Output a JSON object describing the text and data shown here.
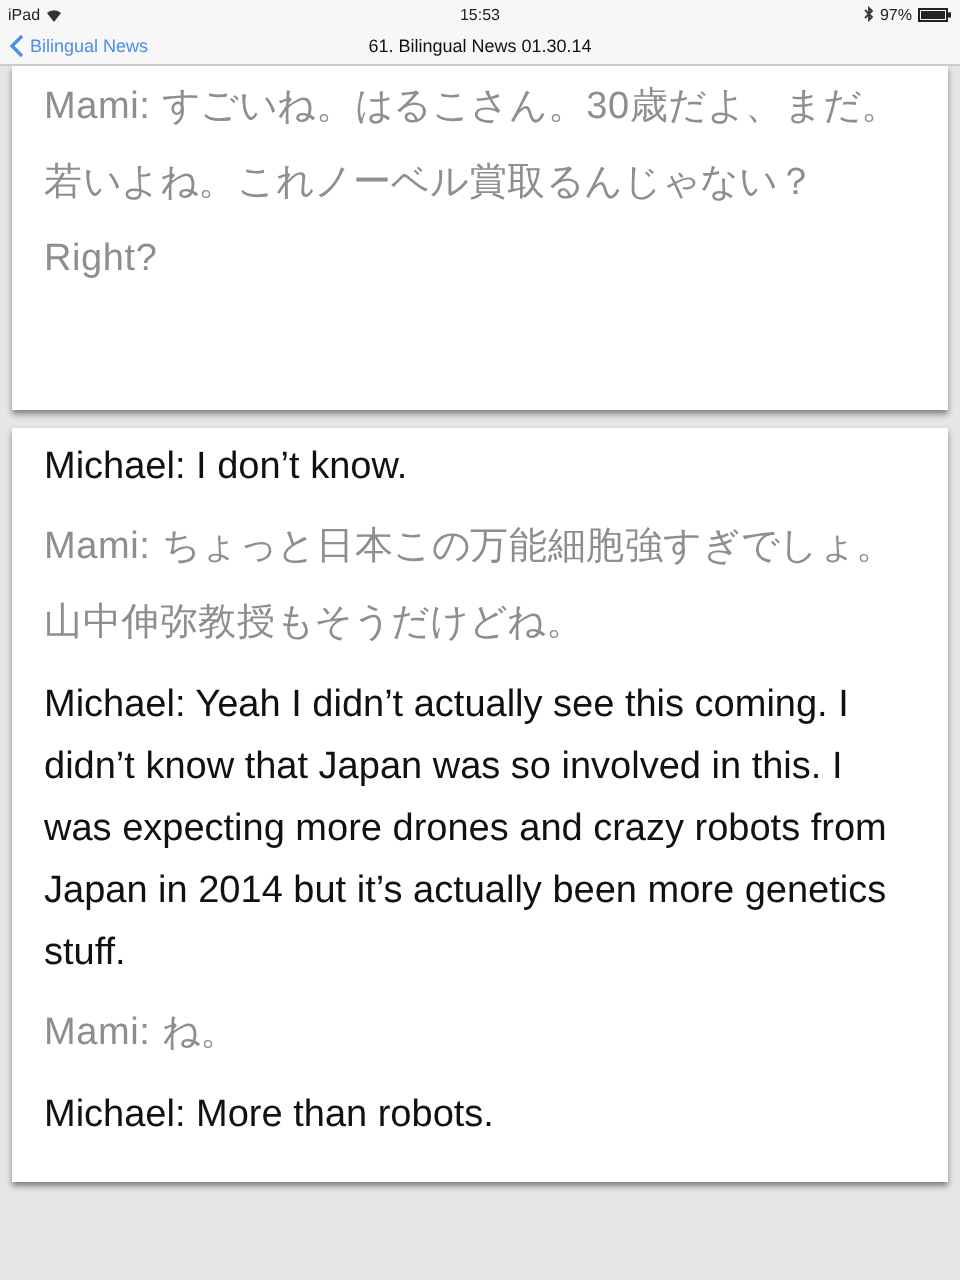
{
  "status_bar": {
    "device": "iPad",
    "time": "15:53",
    "battery": "97%"
  },
  "nav_bar": {
    "back": "Bilingual News",
    "title": "61. Bilingual News 01.30.14"
  },
  "cards": [
    {
      "lines": [
        {
          "kind": "secondary",
          "text": "Mami: すごいね。はるこさん。30歳だよ、まだ。若いよね。これノーベル賞取るんじゃない？Right?"
        }
      ]
    },
    {
      "lines": [
        {
          "kind": "primary",
          "text": "Michael: I don’t know."
        },
        {
          "kind": "secondary",
          "text": "Mami: ちょっと日本この万能細胞強すぎでしょ。山中伸弥教授もそうだけどね。"
        },
        {
          "kind": "primary",
          "text": "Michael: Yeah I didn’t actually see this coming. I didn’t know that Japan was so involved in this. I was expecting more drones and crazy robots from Japan in 2014 but it’s actually been more genetics stuff."
        },
        {
          "kind": "secondary",
          "text": "Mami: ね。"
        },
        {
          "kind": "primary",
          "text": "Michael: More than robots."
        }
      ]
    }
  ]
}
